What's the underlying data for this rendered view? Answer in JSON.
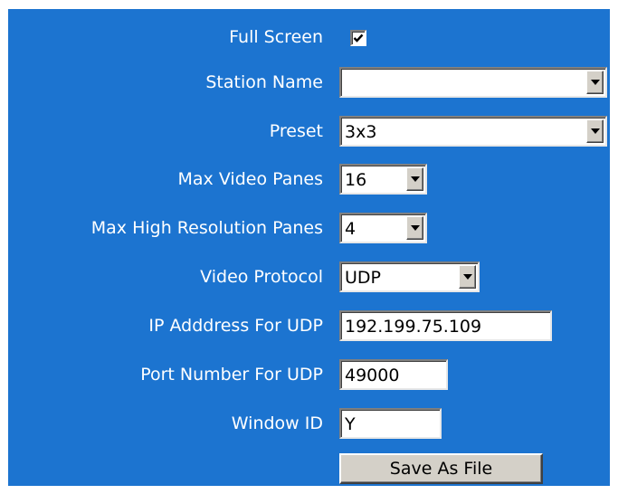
{
  "form": {
    "full_screen": {
      "label": "Full Screen",
      "checked": true
    },
    "station_name": {
      "label": "Station Name",
      "value": ""
    },
    "preset": {
      "label": "Preset",
      "value": "3x3"
    },
    "max_video_panes": {
      "label": "Max Video Panes",
      "value": "16"
    },
    "max_high_res_panes": {
      "label": "Max High Resolution Panes",
      "value": "4"
    },
    "video_protocol": {
      "label": "Video Protocol",
      "value": "UDP"
    },
    "ip_address_udp": {
      "label": "IP Adddress For UDP",
      "value": "192.199.75.109"
    },
    "port_number_udp": {
      "label": "Port Number For UDP",
      "value": "49000"
    },
    "window_id": {
      "label": "Window ID",
      "value": "Y"
    },
    "save_button": {
      "label": "Save As File"
    }
  },
  "colors": {
    "panel_background": "#1c74d0",
    "label_text": "#ffffff",
    "control_face": "#d4d0c8"
  },
  "icons": {
    "checkbox_mark": "checkmark-icon",
    "dropdown_arrow": "chevron-down-icon"
  }
}
